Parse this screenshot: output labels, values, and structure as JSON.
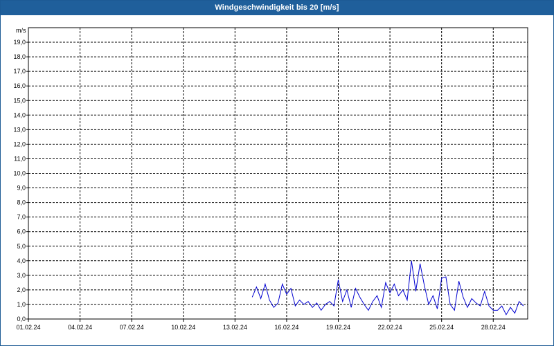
{
  "window": {
    "title": "Windgeschwindigkeit bis 20 [m/s]"
  },
  "colors": {
    "titlebar": "#1f5f9b",
    "series": "#0000d0",
    "grid": "#000000"
  },
  "chart_data": {
    "type": "line",
    "title": "Windgeschwindigkeit bis 20 [m/s]",
    "ylabel": "m/s",
    "ylim": [
      0,
      20
    ],
    "xlim": [
      "01.02.24",
      "01.03.24"
    ],
    "yticks": [
      "0,0",
      "1,0",
      "2,0",
      "3,0",
      "4,0",
      "5,0",
      "6,0",
      "7,0",
      "8,0",
      "9,0",
      "10,0",
      "11,0",
      "12,0",
      "13,0",
      "14,0",
      "15,0",
      "16,0",
      "17,0",
      "18,0",
      "19,0"
    ],
    "xticks": [
      "01.02.24",
      "04.02.24",
      "07.02.24",
      "10.02.24",
      "13.02.24",
      "16.02.24",
      "19.02.24",
      "22.02.24",
      "25.02.24",
      "28.02.24"
    ],
    "grid": true,
    "series": [
      {
        "color": "#0000d0",
        "x": [
          "14.02.24 00:00",
          "14.02.24 06:00",
          "14.02.24 12:00",
          "14.02.24 18:00",
          "15.02.24 00:00",
          "15.02.24 06:00",
          "15.02.24 12:00",
          "15.02.24 18:00",
          "16.02.24 00:00",
          "16.02.24 06:00",
          "16.02.24 12:00",
          "16.02.24 18:00",
          "17.02.24 00:00",
          "17.02.24 06:00",
          "17.02.24 12:00",
          "17.02.24 18:00",
          "18.02.24 00:00",
          "18.02.24 06:00",
          "18.02.24 12:00",
          "18.02.24 18:00",
          "19.02.24 00:00",
          "19.02.24 06:00",
          "19.02.24 12:00",
          "19.02.24 18:00",
          "20.02.24 00:00",
          "20.02.24 06:00",
          "20.02.24 12:00",
          "20.02.24 18:00",
          "21.02.24 00:00",
          "21.02.24 06:00",
          "21.02.24 12:00",
          "21.02.24 18:00",
          "22.02.24 00:00",
          "22.02.24 06:00",
          "22.02.24 12:00",
          "22.02.24 18:00",
          "23.02.24 00:00",
          "23.02.24 06:00",
          "23.02.24 12:00",
          "23.02.24 18:00",
          "24.02.24 00:00",
          "24.02.24 06:00",
          "24.02.24 12:00",
          "24.02.24 18:00",
          "25.02.24 00:00",
          "25.02.24 06:00",
          "25.02.24 12:00",
          "25.02.24 18:00",
          "26.02.24 00:00",
          "26.02.24 06:00",
          "26.02.24 12:00",
          "26.02.24 18:00",
          "27.02.24 00:00",
          "27.02.24 06:00",
          "27.02.24 12:00",
          "27.02.24 18:00",
          "28.02.24 00:00",
          "28.02.24 06:00",
          "28.02.24 12:00",
          "28.02.24 18:00",
          "29.02.24 00:00",
          "29.02.24 06:00",
          "29.02.24 12:00",
          "29.02.24 18:00"
        ],
        "y": [
          1.5,
          2.2,
          1.4,
          2.4,
          1.3,
          0.8,
          1.1,
          2.4,
          1.7,
          2.1,
          0.9,
          1.3,
          1.0,
          1.2,
          0.8,
          1.1,
          0.6,
          1.0,
          1.2,
          0.9,
          2.7,
          1.2,
          2.0,
          0.8,
          2.1,
          1.5,
          1.0,
          0.6,
          1.2,
          1.6,
          0.8,
          2.5,
          1.8,
          2.4,
          1.6,
          2.0,
          1.3,
          4.0,
          1.9,
          3.8,
          2.3,
          1.0,
          1.6,
          0.7,
          2.8,
          2.9,
          1.0,
          0.6,
          2.6,
          1.5,
          0.8,
          1.4,
          1.1,
          0.9,
          1.9,
          0.9,
          0.6,
          0.6,
          0.9,
          0.3,
          0.8,
          0.4,
          1.2,
          0.9
        ]
      }
    ]
  }
}
